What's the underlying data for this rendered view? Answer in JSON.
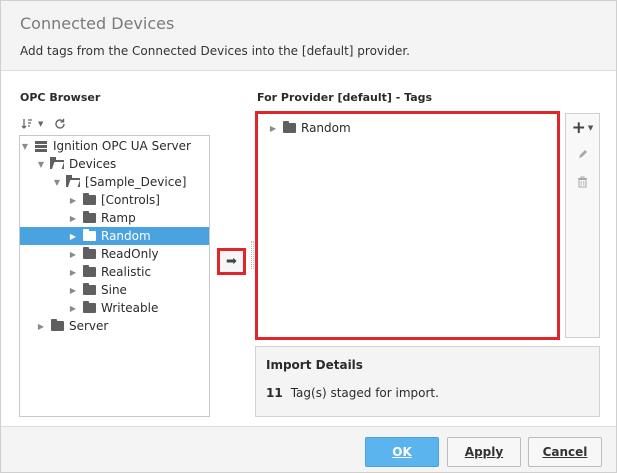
{
  "dialog": {
    "title": "Connected Devices",
    "subtitle": "Add tags from the Connected Devices into the [default] provider."
  },
  "opc_browser": {
    "label": "OPC Browser",
    "tree": [
      {
        "label": "Ignition OPC UA Server",
        "icon": "server-icon",
        "expanded": true,
        "depth": 0
      },
      {
        "label": "Devices",
        "icon": "folder-open-icon",
        "expanded": true,
        "depth": 1
      },
      {
        "label": "[Sample_Device]",
        "icon": "folder-open-icon",
        "expanded": true,
        "depth": 2
      },
      {
        "label": "[Controls]",
        "icon": "folder-icon",
        "expanded": false,
        "depth": 3
      },
      {
        "label": "Ramp",
        "icon": "folder-icon",
        "expanded": false,
        "depth": 3
      },
      {
        "label": "Random",
        "icon": "folder-icon",
        "expanded": false,
        "depth": 3,
        "selected": true
      },
      {
        "label": "ReadOnly",
        "icon": "folder-icon",
        "expanded": false,
        "depth": 3
      },
      {
        "label": "Realistic",
        "icon": "folder-icon",
        "expanded": false,
        "depth": 3
      },
      {
        "label": "Sine",
        "icon": "folder-icon",
        "expanded": false,
        "depth": 3
      },
      {
        "label": "Writeable",
        "icon": "folder-icon",
        "expanded": false,
        "depth": 3
      },
      {
        "label": "Server",
        "icon": "folder-icon",
        "expanded": false,
        "depth": 1
      }
    ]
  },
  "provider_tags": {
    "label": "For Provider [default] - Tags",
    "items": [
      {
        "label": "Random",
        "icon": "folder-icon",
        "expanded": false
      }
    ]
  },
  "import_details": {
    "title": "Import Details",
    "count": "11",
    "text": "Tag(s) staged for import."
  },
  "buttons": {
    "ok": "OK",
    "apply": "Apply",
    "cancel": "Cancel"
  },
  "colors": {
    "highlight": "#e0262b",
    "selection": "#4aa3df",
    "primary_button": "#5cb4ee"
  }
}
